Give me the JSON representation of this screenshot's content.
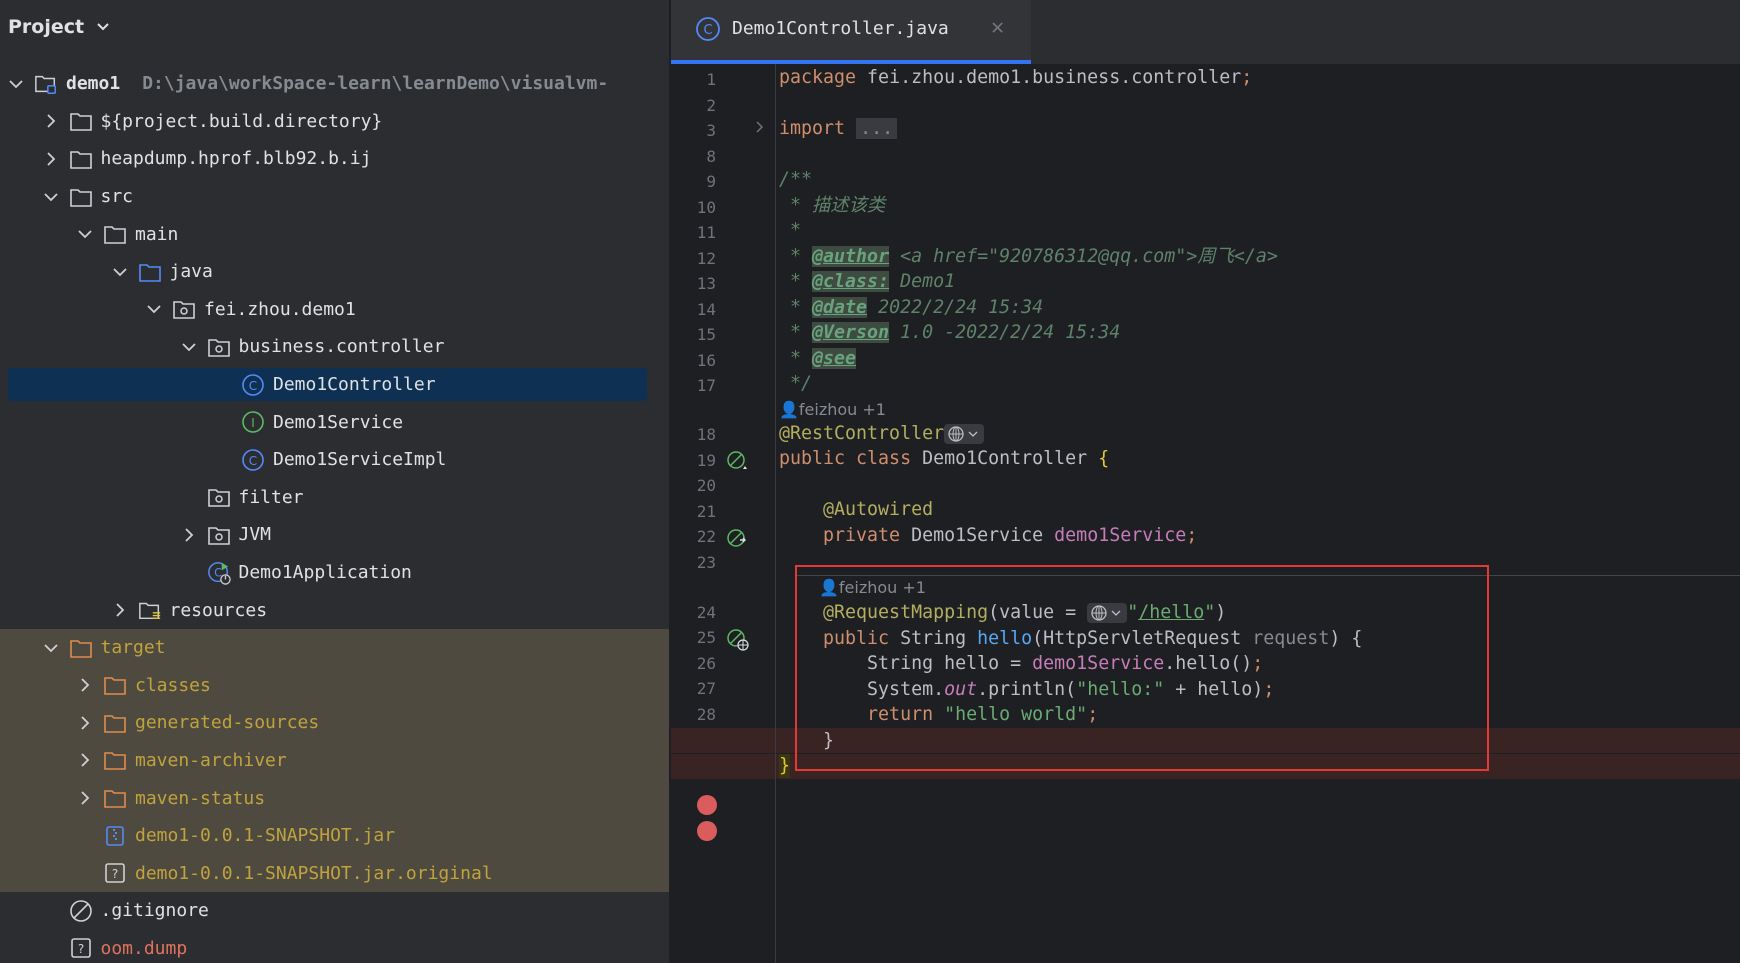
{
  "project": {
    "header": "Project",
    "tree": [
      {
        "label": "demo1",
        "path": "D:\\java\\workSpace-learn\\learnDemo\\visualvm-",
        "chev": "down",
        "icon": "module-folder-icon",
        "depth": 0,
        "bold": true
      },
      {
        "label": "${project.build.directory}",
        "chev": "right",
        "icon": "folder-icon",
        "depth": 1
      },
      {
        "label": "heapdump.hprof.blb92.b.ij",
        "chev": "right",
        "icon": "folder-icon",
        "depth": 1
      },
      {
        "label": "src",
        "chev": "down",
        "icon": "folder-icon",
        "depth": 1
      },
      {
        "label": "main",
        "chev": "down",
        "icon": "folder-icon",
        "depth": 2
      },
      {
        "label": "java",
        "chev": "down",
        "icon": "source-folder-icon",
        "depth": 3
      },
      {
        "label": "fei.zhou.demo1",
        "chev": "down",
        "icon": "package-icon",
        "depth": 4
      },
      {
        "label": "business.controller",
        "chev": "down",
        "icon": "package-icon",
        "depth": 5
      },
      {
        "label": "Demo1Controller",
        "icon": "class-icon",
        "depth": 6,
        "selected": true
      },
      {
        "label": "Demo1Service",
        "icon": "interface-icon",
        "depth": 6
      },
      {
        "label": "Demo1ServiceImpl",
        "icon": "class-icon",
        "depth": 6
      },
      {
        "label": "filter",
        "icon": "package-icon",
        "depth": 5
      },
      {
        "label": "JVM",
        "chev": "right",
        "icon": "package-icon",
        "depth": 5
      },
      {
        "label": "Demo1Application",
        "icon": "spring-app-icon",
        "depth": 5
      },
      {
        "label": "resources",
        "chev": "right",
        "icon": "resources-folder-icon",
        "depth": 3
      },
      {
        "label": "target",
        "chev": "down",
        "icon": "excluded-folder-icon",
        "depth": 1,
        "excluded": true
      },
      {
        "label": "classes",
        "chev": "right",
        "icon": "excluded-folder-icon",
        "depth": 2,
        "excluded": true
      },
      {
        "label": "generated-sources",
        "chev": "right",
        "icon": "excluded-folder-icon",
        "depth": 2,
        "excluded": true
      },
      {
        "label": "maven-archiver",
        "chev": "right",
        "icon": "excluded-folder-icon",
        "depth": 2,
        "excluded": true
      },
      {
        "label": "maven-status",
        "chev": "right",
        "icon": "excluded-folder-icon",
        "depth": 2,
        "excluded": true
      },
      {
        "label": "demo1-0.0.1-SNAPSHOT.jar",
        "icon": "jar-icon",
        "depth": 2,
        "excluded": true
      },
      {
        "label": "demo1-0.0.1-SNAPSHOT.jar.original",
        "icon": "unknown-file-icon",
        "depth": 2,
        "excluded": true
      },
      {
        "label": ".gitignore",
        "icon": "ignore-file-icon",
        "depth": 1
      },
      {
        "label": "oom.dump",
        "icon": "unknown-file-icon",
        "depth": 1,
        "danger": true
      }
    ]
  },
  "editor": {
    "tab_label": "Demo1Controller.java",
    "line_numbers": [
      "1",
      "2",
      "3",
      "8",
      "9",
      "10",
      "11",
      "12",
      "13",
      "14",
      "15",
      "16",
      "17",
      "18",
      "19",
      "20",
      "21",
      "22",
      "23",
      "24",
      "25",
      "26",
      "27",
      "28"
    ],
    "inlay_author_1": "feizhou +1",
    "inlay_author_2": "feizhou +1",
    "code": {
      "l1_kw": "package",
      "l1_rest": " fei.zhou.demo1.business.controller",
      "semi": ";",
      "l3_kw": "import",
      "l3_fold": "...",
      "l9": "/**",
      "l10": " * 描述该类",
      "l11": " *",
      "l12_star": " * ",
      "l12_tag": "@author",
      "l12_rest": " <a href=\"920786312@qq.com\">周飞</a>",
      "l13_star": " * ",
      "l13_tag": "@class:",
      "l13_rest": " Demo1",
      "l14_star": " * ",
      "l14_tag": "@date",
      "l14_rest": " 2022/2/24 15:34",
      "l15_star": " * ",
      "l15_tag": "@Verson",
      "l15_rest": " 1.0 -2022/2/24 15:34",
      "l16_star": " * ",
      "l16_tag": "@see",
      "l17": " */",
      "l18_ann": "@RestController",
      "l19_kw": "public class ",
      "l19_name": "Demo1Controller ",
      "l19_brace": "{",
      "l21_ann": "    @Autowired",
      "l22_kw": "    private ",
      "l22_type": "Demo1Service ",
      "l22_field": "demo1Service",
      "l24_ann": "    @RequestMapping",
      "l24_mid": "(value = ",
      "l24_q1": "\"",
      "l24_str": "/hello",
      "l24_q2": "\"",
      "l24_end": ")",
      "l25_kw": "    public ",
      "l25_type": "String ",
      "l25_fn": "hello",
      "l25_p1": "(HttpServletRequest ",
      "l25_param": "request",
      "l25_end": ") {",
      "l26_a": "        String hello = ",
      "l26_field": "demo1Service",
      "l26_b": ".hello()",
      "l27_a": "        System.",
      "l27_static": "out",
      "l27_b": ".println(",
      "l27_str": "\"hello:\"",
      "l27_c": " + hello)",
      "l28_kw": "        return ",
      "l28_str": "\"hello world\"",
      "l29": "    }",
      "l30": "}"
    }
  },
  "colors": {
    "selection": "#0e3153",
    "excluded_bg": "#4f4a3f",
    "excluded_text": "#c0a33d",
    "breakpoint": "#db5c5c",
    "highlight_box": "#e53935"
  }
}
